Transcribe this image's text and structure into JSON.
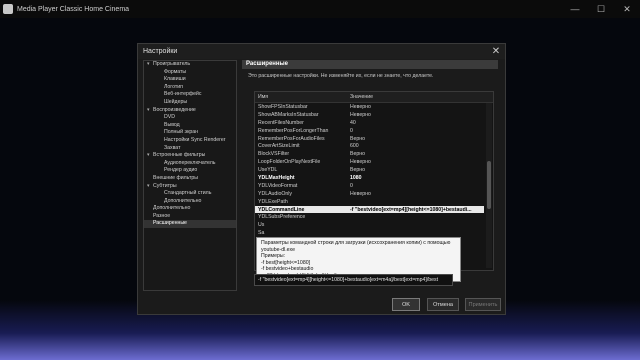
{
  "app": {
    "title": "Media Player Classic Home Cinema"
  },
  "dialog": {
    "title": "Настройки",
    "section": "Расширенные",
    "description": "Это расширенные настройки. Не изменяйте их, если не знаете, что делаете.",
    "buttons": {
      "ok": "OK",
      "cancel": "Отмена",
      "apply": "Применить"
    }
  },
  "tree": [
    {
      "label": "Проигрыватель",
      "level": 0,
      "expandable": true
    },
    {
      "label": "Форматы",
      "level": 1
    },
    {
      "label": "Клавиши",
      "level": 1
    },
    {
      "label": "Логотип",
      "level": 1
    },
    {
      "label": "Веб-интерфейс",
      "level": 1
    },
    {
      "label": "Шейдеры",
      "level": 1
    },
    {
      "label": "Воспроизведение",
      "level": 0,
      "expandable": true
    },
    {
      "label": "DVD",
      "level": 1
    },
    {
      "label": "Вывод",
      "level": 1
    },
    {
      "label": "Полный экран",
      "level": 1
    },
    {
      "label": "Настройки Sync Renderer",
      "level": 1
    },
    {
      "label": "Захват",
      "level": 1
    },
    {
      "label": "Встроенные фильтры",
      "level": 0,
      "expandable": true
    },
    {
      "label": "Аудиопереключатель",
      "level": 1
    },
    {
      "label": "Рендер аудио",
      "level": 1
    },
    {
      "label": "Внешние фильтры",
      "level": 0
    },
    {
      "label": "Субтитры",
      "level": 0,
      "expandable": true
    },
    {
      "label": "Стандартный стиль",
      "level": 1
    },
    {
      "label": "Дополнительно",
      "level": 1
    },
    {
      "label": "Дополнительно",
      "level": 0
    },
    {
      "label": "Разное",
      "level": 0
    },
    {
      "label": "Расширенные",
      "level": 0,
      "selected": true
    }
  ],
  "grid": {
    "columns": {
      "name": "Имя",
      "value": "Значение"
    },
    "rows": [
      {
        "name": "ShowFPSInStatusbar",
        "value": "Неверно"
      },
      {
        "name": "ShowABMarksInStatusbar",
        "value": "Неверно"
      },
      {
        "name": "RecentFilesNumber",
        "value": "40"
      },
      {
        "name": "RememberPosForLongerThan",
        "value": "0"
      },
      {
        "name": "RememberPosForAudioFiles",
        "value": "Верно"
      },
      {
        "name": "CoverArtSizeLimit",
        "value": "600"
      },
      {
        "name": "BlockVSFilter",
        "value": "Верно"
      },
      {
        "name": "LoopFolderOnPlayNextFile",
        "value": "Неверно"
      },
      {
        "name": "UseYDL",
        "value": "Верно"
      },
      {
        "name": "YDLMaxHeight",
        "value": "1080",
        "bold": true
      },
      {
        "name": "YDLVideoFormat",
        "value": "0"
      },
      {
        "name": "YDLAudioOnly",
        "value": "Неверно"
      },
      {
        "name": "YDLExePath",
        "value": ""
      },
      {
        "name": "YDLCommandLine",
        "value": "-f \"bestvideo[ext=mp4][height<=1080]+bestaudi...",
        "selected": true
      },
      {
        "name": "YDLSubsPreference",
        "value": ""
      },
      {
        "name": "Us",
        "value": ""
      },
      {
        "name": "Sa",
        "value": ""
      },
      {
        "name": "Sa",
        "value": ""
      },
      {
        "name": "Sn",
        "value": ""
      },
      {
        "name": "Sn",
        "value": ""
      }
    ]
  },
  "tooltip": {
    "lines": [
      "Параметры командной строки для загрузки (исхсохранения копии) с помощью",
      "youtube-dl.exe",
      "Примеры:",
      "-f best[height<=1080]",
      "-f bestvideo+bestaudio",
      "-o \"C:\\downloads\\%(title)s.%(ext)s"
    ]
  },
  "edit": {
    "value": "-f \"bestvideo[ext=mp4][height<=1080]+bestaudio[ext=m4a]/best[ext=mp4]/best"
  }
}
